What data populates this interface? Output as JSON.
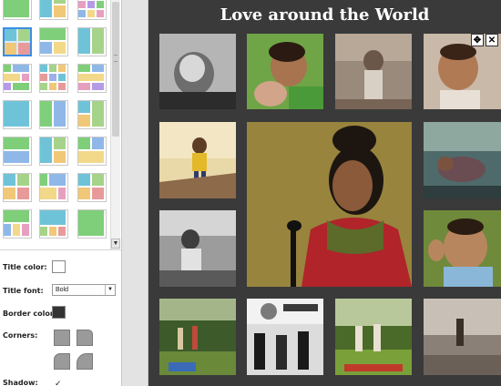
{
  "collage": {
    "title": "Love around the World"
  },
  "options": {
    "title_color_label": "Title color:",
    "title_font_label": "Title font:",
    "title_font_value": "Bold",
    "border_color_label": "Border color:",
    "corners_label": "Corners:",
    "shadow_label": "Shadow:",
    "shadow_checked": true,
    "check_glyph": "✓"
  },
  "tools": {
    "move_glyph": "✥",
    "close_glyph": "✕"
  },
  "scroll": {
    "down_glyph": "▼"
  },
  "colors": {
    "accent": "#3a8ee6",
    "canvas_bg": "#3a3a3a",
    "title_text": "#ffffff"
  },
  "layout_thumbs": [
    {
      "name": "layout-thumb-1",
      "selected": false
    },
    {
      "name": "layout-thumb-2",
      "selected": false
    },
    {
      "name": "layout-thumb-3",
      "selected": false
    },
    {
      "name": "layout-thumb-4",
      "selected": true
    },
    {
      "name": "layout-thumb-5",
      "selected": false
    },
    {
      "name": "layout-thumb-6",
      "selected": false
    },
    {
      "name": "layout-thumb-7",
      "selected": false
    },
    {
      "name": "layout-thumb-8",
      "selected": false
    },
    {
      "name": "layout-thumb-9",
      "selected": false
    },
    {
      "name": "layout-thumb-10",
      "selected": false
    },
    {
      "name": "layout-thumb-11",
      "selected": false
    },
    {
      "name": "layout-thumb-12",
      "selected": false
    },
    {
      "name": "layout-thumb-13",
      "selected": false
    },
    {
      "name": "layout-thumb-14",
      "selected": false
    },
    {
      "name": "layout-thumb-15",
      "selected": false
    },
    {
      "name": "layout-thumb-16",
      "selected": false
    },
    {
      "name": "layout-thumb-17",
      "selected": false
    },
    {
      "name": "layout-thumb-18",
      "selected": false
    },
    {
      "name": "layout-thumb-19",
      "selected": false
    },
    {
      "name": "layout-thumb-20",
      "selected": false
    },
    {
      "name": "layout-thumb-21",
      "selected": false
    }
  ]
}
